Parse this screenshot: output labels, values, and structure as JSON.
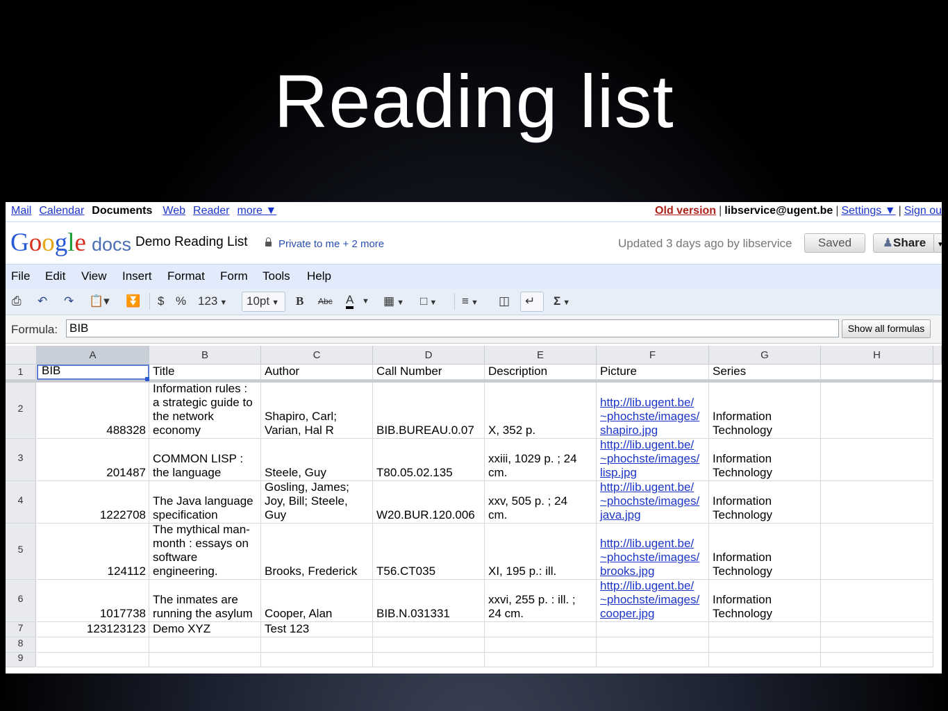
{
  "slide_title": "Reading list",
  "gbar": {
    "left_links": [
      "Mail",
      "Calendar",
      "Documents",
      "Web",
      "Reader",
      "more ▼"
    ],
    "active": "Documents",
    "old_version": "Old version",
    "user": "libservice@ugent.be",
    "settings": "Settings ▼",
    "signout": "Sign ou"
  },
  "header": {
    "logo_text": "Google",
    "logo_docs": "docs",
    "doc_name": "Demo Reading List",
    "sharing": "Private to me + 2 more",
    "updated": "Updated 3 days ago by libservice",
    "saved": "Saved",
    "share": "Share"
  },
  "menu": [
    "File",
    "Edit",
    "View",
    "Insert",
    "Format",
    "Form",
    "Tools",
    "Help"
  ],
  "toolbar": {
    "currency": "$",
    "percent": "%",
    "number_format": "123",
    "font_size": "10pt",
    "bold": "B",
    "strike": "Abc",
    "font_color": "A",
    "sum": "Σ"
  },
  "formula": {
    "label": "Formula:",
    "value": "BIB",
    "show_all": "Show all formulas"
  },
  "columns": [
    "A",
    "B",
    "C",
    "D",
    "E",
    "F",
    "G",
    "H"
  ],
  "rows": [
    {
      "n": "1",
      "cells": [
        "BIB",
        "Title",
        "Author",
        "Call Number",
        "Description",
        "Picture",
        "Series",
        ""
      ]
    },
    {
      "n": "2",
      "cells": [
        "488328",
        "Information rules :\na strategic guide to\nthe network\neconomy",
        "Shapiro, Carl;\nVarian, Hal R",
        "BIB.BUREAU.0.07",
        "X, 352 p.",
        "http://lib.ugent.be/\n~phochste/images/\nshapiro.jpg",
        "Information\nTechnology",
        ""
      ]
    },
    {
      "n": "3",
      "cells": [
        "201487",
        "COMMON LISP :\nthe language",
        "Steele, Guy",
        "T80.05.02.135",
        "xxiii, 1029 p. ; 24\ncm.",
        "http://lib.ugent.be/\n~phochste/images/\nlisp.jpg",
        "Information\nTechnology",
        ""
      ]
    },
    {
      "n": "4",
      "cells": [
        "1222708",
        "The Java language\nspecification",
        "Gosling, James;\nJoy, Bill; Steele,\nGuy",
        "W20.BUR.120.006",
        "xxv, 505 p. ; 24\ncm.",
        "http://lib.ugent.be/\n~phochste/images/\njava.jpg",
        "Information\nTechnology",
        ""
      ]
    },
    {
      "n": "5",
      "cells": [
        "124112",
        "The mythical man-\nmonth : essays on\nsoftware\nengineering.",
        "Brooks, Frederick",
        "T56.CT035",
        "XI, 195 p.: ill.",
        "http://lib.ugent.be/\n~phochste/images/\nbrooks.jpg",
        "Information\nTechnology",
        ""
      ]
    },
    {
      "n": "6",
      "cells": [
        "1017738",
        "The inmates are\nrunning the asylum",
        "Cooper, Alan",
        "BIB.N.031331",
        "xxvi, 255 p. : ill. ;\n24 cm.",
        "http://lib.ugent.be/\n~phochste/images/\ncooper.jpg",
        "Information\nTechnology",
        ""
      ]
    },
    {
      "n": "7",
      "cells": [
        "123123123",
        "Demo XYZ",
        "Test 123",
        "",
        "",
        "",
        "",
        ""
      ]
    },
    {
      "n": "8",
      "cells": [
        "",
        "",
        "",
        "",
        "",
        "",
        "",
        ""
      ]
    },
    {
      "n": "9",
      "cells": [
        "",
        "",
        "",
        "",
        "",
        "",
        "",
        ""
      ]
    }
  ],
  "colors": {
    "link": "#1c35c9",
    "menubar": "#e2ebfb",
    "old_version": "#b0201a"
  }
}
